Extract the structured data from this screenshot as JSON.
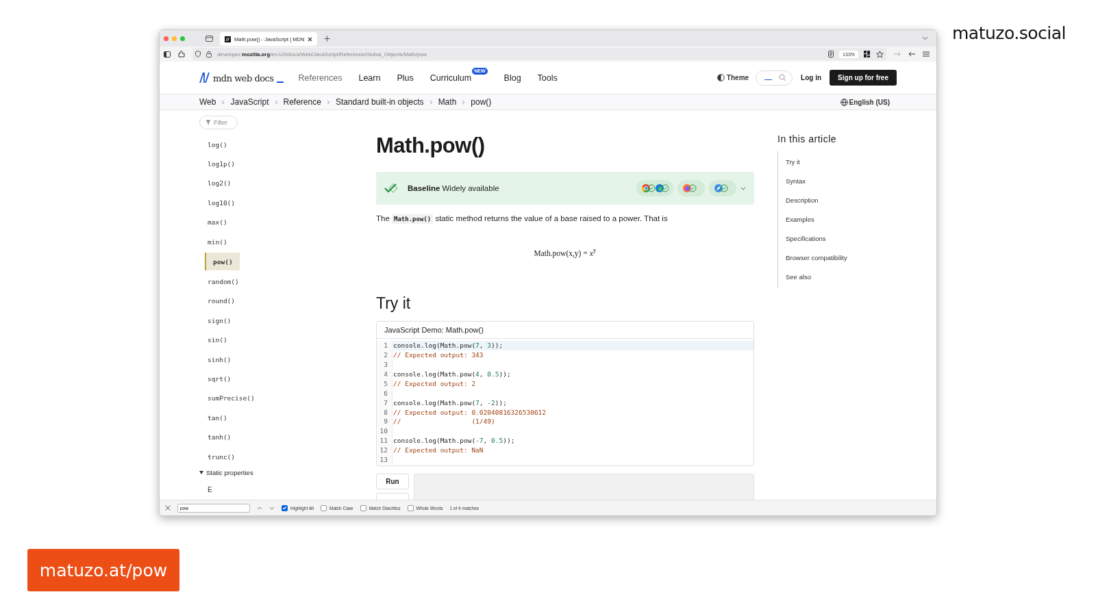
{
  "slide": {
    "handle": "matuzo.social",
    "link": "matuzo.at/pow"
  },
  "browser": {
    "tab_title": "Math.pow() - JavaScript | MDN",
    "url": "developer.**mozilla.org**/en-US/docs/Web/JavaScript/Reference/Global_Objects/Math/pow",
    "zoom": "133%"
  },
  "header": {
    "logo": "mdn web docs",
    "nav": [
      {
        "label": "References",
        "selected": true
      },
      {
        "label": "Learn",
        "selected": false
      },
      {
        "label": "Plus",
        "selected": false
      },
      {
        "label": "Curriculum",
        "selected": false,
        "badge": "NEW"
      },
      {
        "label": "Blog",
        "selected": false
      },
      {
        "label": "Tools",
        "selected": false
      }
    ],
    "theme": "Theme",
    "login": "Log in",
    "signup": "Sign up for free"
  },
  "breadcrumbs": [
    "Web",
    "JavaScript",
    "Reference",
    "Standard built-in objects",
    "Math",
    "pow()"
  ],
  "language": "English (US)",
  "sidebar": {
    "filter_placeholder": "Filter",
    "items": [
      {
        "label": "log()",
        "selected": false
      },
      {
        "label": "log1p()",
        "selected": false
      },
      {
        "label": "log2()",
        "selected": false
      },
      {
        "label": "log10()",
        "selected": false
      },
      {
        "label": "max()",
        "selected": false
      },
      {
        "label": "min()",
        "selected": false
      },
      {
        "label": "pow()",
        "selected": true
      },
      {
        "label": "random()",
        "selected": false
      },
      {
        "label": "round()",
        "selected": false
      },
      {
        "label": "sign()",
        "selected": false
      },
      {
        "label": "sin()",
        "selected": false
      },
      {
        "label": "sinh()",
        "selected": false
      },
      {
        "label": "sqrt()",
        "selected": false
      },
      {
        "label": "sumPrecise()",
        "selected": false
      },
      {
        "label": "tan()",
        "selected": false
      },
      {
        "label": "tanh()",
        "selected": false
      },
      {
        "label": "trunc()",
        "selected": false
      }
    ],
    "section": {
      "label": "Static properties",
      "expanded": true,
      "children": [
        {
          "label": "E"
        }
      ]
    }
  },
  "article": {
    "title": "Math.pow()",
    "baseline": {
      "label": "Baseline",
      "status": "Widely available"
    },
    "description": {
      "before": "The",
      "code": "Math.pow()",
      "after": "static method returns the value of a base raised to a power. That is"
    },
    "formula": "Math.pow(x,y) = *x*$^{y}$",
    "try_it": {
      "heading": "Try it",
      "demo_title": "JavaScript Demo: Math.pow()",
      "lines": [
        {
          "number": "1",
          "active": true,
          "tokens": [
            {
              "kind": "plain",
              "text": "console.log(Math.pow("
            },
            {
              "kind": "number",
              "text": "7"
            },
            {
              "kind": "plain",
              "text": ", "
            },
            {
              "kind": "number",
              "text": "3"
            },
            {
              "kind": "plain",
              "text": "));"
            }
          ]
        },
        {
          "number": "2",
          "active": false,
          "tokens": [
            {
              "kind": "comment",
              "text": "// Expected output: 343"
            }
          ]
        },
        {
          "number": "3",
          "active": false
        },
        {
          "number": "4",
          "active": false,
          "tokens": [
            {
              "kind": "plain",
              "text": "console.log(Math.pow("
            },
            {
              "kind": "number",
              "text": "4"
            },
            {
              "kind": "plain",
              "text": ", "
            },
            {
              "kind": "number",
              "text": "0.5"
            },
            {
              "kind": "plain",
              "text": "));"
            }
          ]
        },
        {
          "number": "5",
          "active": false,
          "tokens": [
            {
              "kind": "comment",
              "text": "// Expected output: 2"
            }
          ]
        },
        {
          "number": "6",
          "active": false
        },
        {
          "number": "7",
          "active": false,
          "tokens": [
            {
              "kind": "plain",
              "text": "console.log(Math.pow("
            },
            {
              "kind": "number",
              "text": "7"
            },
            {
              "kind": "plain",
              "text": ", "
            },
            {
              "kind": "number",
              "text": "-2"
            },
            {
              "kind": "plain",
              "text": "));"
            }
          ]
        },
        {
          "number": "8",
          "active": false,
          "tokens": [
            {
              "kind": "comment",
              "text": "// Expected output: 0.02040816326530612"
            }
          ]
        },
        {
          "number": "9",
          "active": false,
          "tokens": [
            {
              "kind": "comment",
              "text": "//                  (1/49)"
            }
          ]
        },
        {
          "number": "10",
          "active": false
        },
        {
          "number": "11",
          "active": false,
          "tokens": [
            {
              "kind": "plain",
              "text": "console.log(Math.pow("
            },
            {
              "kind": "number",
              "text": "-7"
            },
            {
              "kind": "plain",
              "text": ", "
            },
            {
              "kind": "number",
              "text": "0.5"
            },
            {
              "kind": "plain",
              "text": "));"
            }
          ]
        },
        {
          "number": "12",
          "active": false,
          "tokens": [
            {
              "kind": "comment",
              "text": "// Expected output: NaN"
            }
          ]
        },
        {
          "number": "13",
          "active": false
        }
      ],
      "run_button": "Run"
    }
  },
  "toc": {
    "heading": "In this article",
    "items": [
      "Try it",
      "Syntax",
      "Description",
      "Examples",
      "Specifications",
      "Browser compatibility",
      "See also"
    ]
  },
  "find_bar": {
    "query": "pow",
    "options": [
      {
        "label": "Highlight All",
        "checked": true
      },
      {
        "label": "Match Case",
        "checked": false
      },
      {
        "label": "Match Diacritics",
        "checked": false
      },
      {
        "label": "Whole Words",
        "checked": false
      }
    ],
    "result": "1 of 4 matches"
  }
}
